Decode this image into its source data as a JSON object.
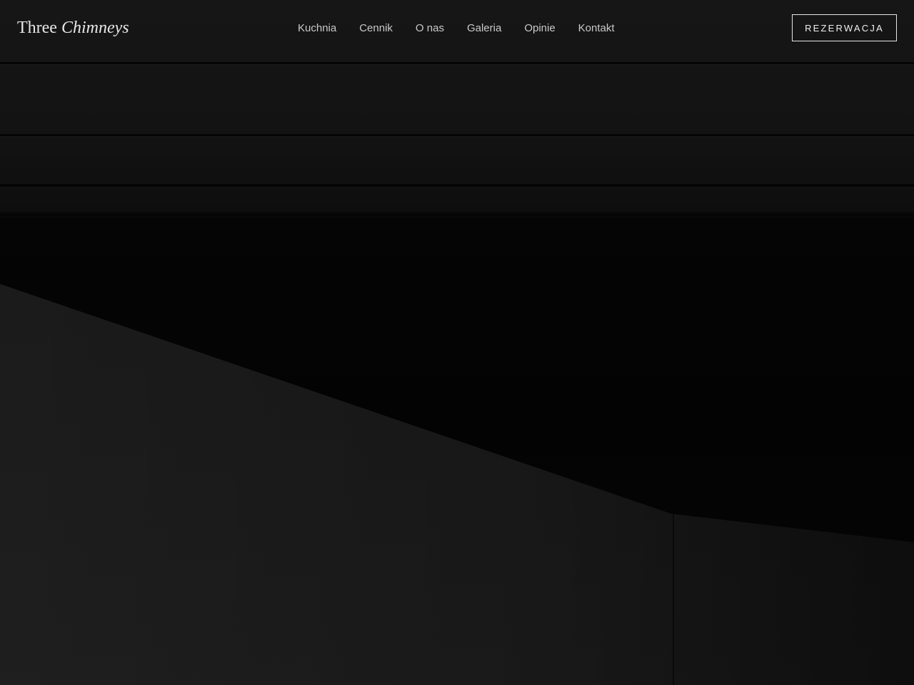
{
  "brand": {
    "name_part1": "Three",
    "name_part2": "Chimneys"
  },
  "nav": {
    "items": [
      {
        "label": "Kuchnia"
      },
      {
        "label": "Cennik"
      },
      {
        "label": "O nas"
      },
      {
        "label": "Galeria"
      },
      {
        "label": "Opinie"
      },
      {
        "label": "Kontakt"
      }
    ]
  },
  "header": {
    "cta_label": "REZERWACJA"
  },
  "colors": {
    "background": "#0a0a0a",
    "text": "#e8e8e8",
    "nav_text": "#c9c9c9",
    "button_border": "#e6e6e6"
  }
}
